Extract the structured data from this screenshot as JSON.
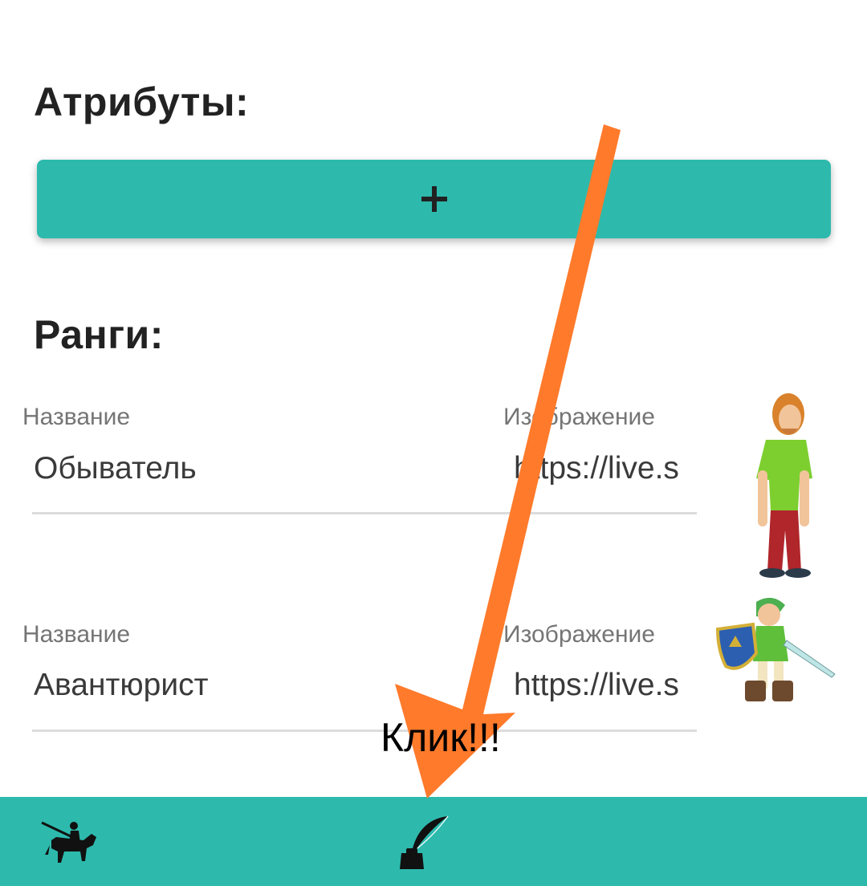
{
  "sections": {
    "attributes_title": "Атрибуты:",
    "ranks_title": "Ранги:"
  },
  "add_button": {
    "icon": "plus-icon"
  },
  "ranks": [
    {
      "name_label": "Название",
      "name_value": "Обыватель",
      "image_label": "Изображение",
      "image_value": "https://live.s",
      "image_icon": "shaggy-character-image"
    },
    {
      "name_label": "Название",
      "name_value": "Авантюрист",
      "image_label": "Изображение",
      "image_value": "https://live.s",
      "image_icon": "link-character-image"
    }
  ],
  "annotation": {
    "text": "Клик!!!",
    "arrow_color": "#ff7a2b"
  },
  "bottom_nav": {
    "items": [
      {
        "icon": "knight-rider-icon"
      },
      {
        "icon": "quill-inkwell-icon"
      }
    ]
  },
  "colors": {
    "accent": "#2dbaad",
    "arrow": "#ff7a2b"
  }
}
